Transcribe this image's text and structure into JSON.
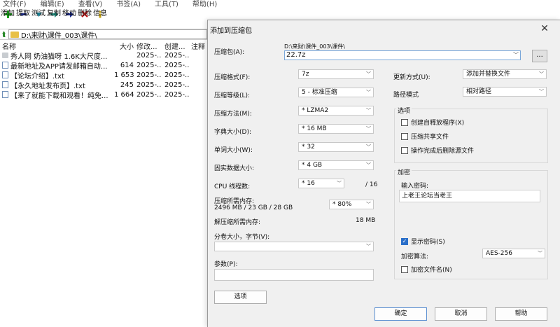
{
  "menubar": [
    "文件(F)",
    "编辑(E)",
    "查看(V)",
    "书签(A)",
    "工具(T)",
    "帮助(H)"
  ],
  "toolbar": [
    {
      "label": "添加",
      "icon": "plus-icon",
      "color": "#1aa11a"
    },
    {
      "label": "提取",
      "icon": "minus-icon",
      "color": "#1a2a8a"
    },
    {
      "label": "测试",
      "icon": "check-icon",
      "color": "#1a8aa0"
    },
    {
      "label": "复制",
      "icon": "arrow-right-icon",
      "color": "#1a8a7a"
    },
    {
      "label": "移动",
      "icon": "arrow-right-icon",
      "color": "#1a2a8a"
    },
    {
      "label": "删除",
      "icon": "x-icon",
      "color": "#c01818"
    },
    {
      "label": "信息",
      "icon": "info-icon",
      "color": "#c0a010"
    }
  ],
  "address": "D:\\来财\\课件_003\\课件\\",
  "file_columns": {
    "name": "名称",
    "size": "大小",
    "modified": "修改...",
    "created": "创建...",
    "note": "注释"
  },
  "files": [
    {
      "name": "秀人网 奶油猫呀 1.6K大尺度...",
      "size": "",
      "modified": "2025-...",
      "created": "2025-...",
      "type": "folder"
    },
    {
      "name": "最新地址及APP请发邮箱自动...",
      "size": "614",
      "modified": "2025-...",
      "created": "2025-...",
      "type": "txt"
    },
    {
      "name": "【论坛介绍】.txt",
      "size": "1 653",
      "modified": "2025-...",
      "created": "2025-...",
      "type": "txt"
    },
    {
      "name": "【永久地址发布页】.txt",
      "size": "245",
      "modified": "2025-...",
      "created": "2025-...",
      "type": "txt"
    },
    {
      "name": "【来了就能下载和观看！纯免...",
      "size": "1 664",
      "modified": "2025-...",
      "created": "2025-...",
      "type": "txt"
    }
  ],
  "dialog": {
    "title": "添加到压缩包",
    "archive_label": "压缩包(A):",
    "archive_path": "D:\\来财\\课件_003\\课件\\",
    "archive_name": "22.7z",
    "browse_label": "...",
    "format_label": "压缩格式(F):",
    "format_value": "7z",
    "level_label": "压缩等级(L):",
    "level_value": "5 - 标准压缩",
    "method_label": "压缩方法(M):",
    "method_value": "*  LZMA2",
    "dict_label": "字典大小(D):",
    "dict_value": "*  16 MB",
    "word_label": "单词大小(W):",
    "word_value": "*  32",
    "solid_label": "固实数据大小:",
    "solid_value": "*  4 GB",
    "threads_label": "CPU 线程数:",
    "threads_value": "*  16",
    "threads_total": "/ 16",
    "mem_compress_label": "压缩所需内存:",
    "mem_compress_value": "2496 MB / 23 GB / 28 GB",
    "mem_percent": "* 80%",
    "mem_decompress_label": "解压缩所需内存:",
    "mem_decompress_value": "18 MB",
    "volume_label": "分卷大小，字节(V):",
    "params_label": "参数(P):",
    "options_button": "选项",
    "update_label": "更新方式(U):",
    "update_value": "添加并替换文件",
    "pathmode_label": "路径模式",
    "pathmode_value": "相对路径",
    "options_group": "选项",
    "opt_sfx": "创建自释放程序(X)",
    "opt_shared": "压缩共享文件",
    "opt_delete": "操作完成后删除源文件",
    "encrypt_group": "加密",
    "pw_label": "输入密码:",
    "pw_value": "上老王论坛当老王",
    "show_pw": "显示密码(S)",
    "enc_method_label": "加密算法:",
    "enc_method_value": "AES-256",
    "enc_names": "加密文件名(N)",
    "ok": "确定",
    "cancel": "取消",
    "help": "帮助"
  }
}
